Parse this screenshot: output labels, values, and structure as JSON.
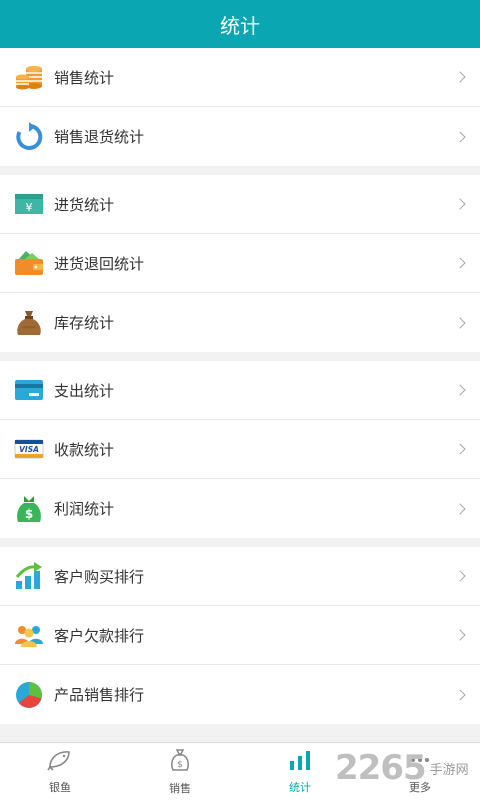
{
  "header": {
    "title": "统计"
  },
  "groups": [
    {
      "items": [
        {
          "label": "销售统计",
          "icon": "coins-icon"
        },
        {
          "label": "销售退货统计",
          "icon": "return-arrow-icon"
        }
      ]
    },
    {
      "items": [
        {
          "label": "进货统计",
          "icon": "yuan-note-icon"
        },
        {
          "label": "进货退回统计",
          "icon": "wallet-icon"
        },
        {
          "label": "库存统计",
          "icon": "money-sack-icon"
        }
      ]
    },
    {
      "items": [
        {
          "label": "支出统计",
          "icon": "credit-card-icon"
        },
        {
          "label": "收款统计",
          "icon": "visa-card-icon"
        },
        {
          "label": "利润统计",
          "icon": "dollar-bag-icon"
        }
      ]
    },
    {
      "items": [
        {
          "label": "客户购买排行",
          "icon": "growth-chart-icon"
        },
        {
          "label": "客户欠款排行",
          "icon": "people-icon"
        },
        {
          "label": "产品销售排行",
          "icon": "pie-chart-icon"
        }
      ]
    }
  ],
  "tabbar": {
    "tabs": [
      {
        "label": "银鱼",
        "icon": "fish-icon",
        "active": false
      },
      {
        "label": "销售",
        "icon": "money-bag-outline-icon",
        "active": false
      },
      {
        "label": "统计",
        "icon": "bar-chart-icon",
        "active": true
      },
      {
        "label": "更多",
        "icon": "more-icon",
        "active": false
      }
    ]
  },
  "watermark": {
    "number": "2265",
    "suffix": "手游网"
  },
  "colors": {
    "accent": "#0aa7b3"
  }
}
